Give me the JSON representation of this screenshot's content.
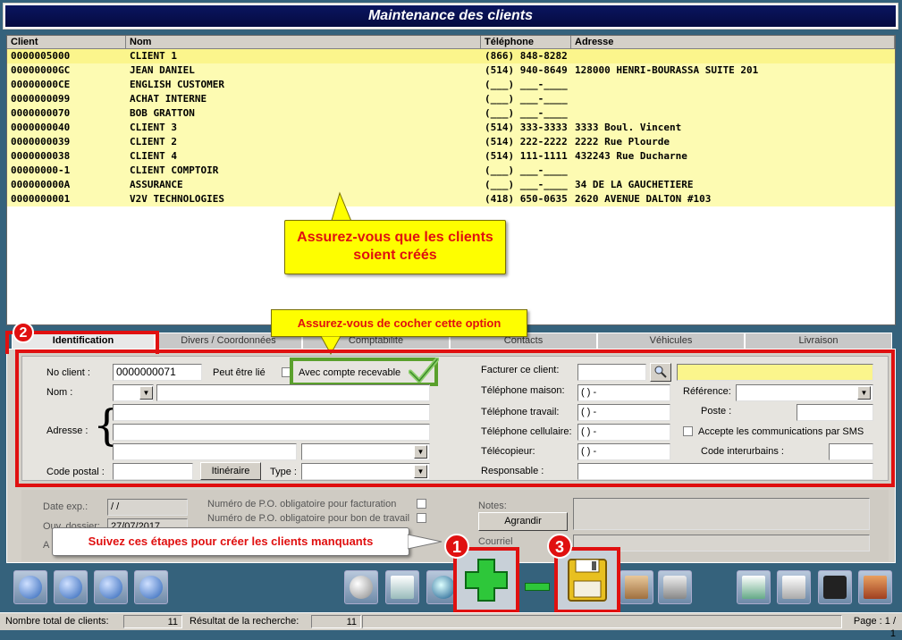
{
  "window": {
    "title": "Maintenance des clients"
  },
  "grid": {
    "headers": [
      "Client",
      "Nom",
      "Téléphone",
      "Adresse"
    ],
    "rows": [
      [
        "0000005000",
        "CLIENT 1",
        "(866) 848-8282",
        ""
      ],
      [
        "00000000GC",
        "JEAN DANIEL",
        "(514) 940-8649",
        "128000 HENRI-BOURASSA SUITE 201"
      ],
      [
        "00000000CE",
        "ENGLISH CUSTOMER",
        "(___) ___-____",
        ""
      ],
      [
        "0000000099",
        "ACHAT INTERNE",
        "(___) ___-____",
        ""
      ],
      [
        "0000000070",
        "BOB GRATTON",
        "(___) ___-____",
        ""
      ],
      [
        "0000000040",
        "CLIENT 3",
        "(514) 333-3333",
        "3333 Boul. Vincent"
      ],
      [
        "0000000039",
        "CLIENT 2",
        "(514) 222-2222",
        "2222 Rue Plourde"
      ],
      [
        "0000000038",
        "CLIENT 4",
        "(514) 111-1111",
        "432243 Rue Ducharne"
      ],
      [
        "00000000-1",
        "CLIENT COMPTOIR",
        "(___) ___-____",
        ""
      ],
      [
        "000000000A",
        "ASSURANCE",
        "(___) ___-____",
        "34 DE LA GAUCHETIERE"
      ],
      [
        "0000000001",
        "V2V TECHNOLOGIES",
        "(418) 650-0635",
        "2620 AVENUE DALTON #103"
      ]
    ]
  },
  "callouts": {
    "clients": "Assurez-vous que les clients soient créés",
    "option": "Assurez-vous de cocher cette option",
    "steps": "Suivez ces étapes pour créer les clients manquants"
  },
  "badges": {
    "one": "1",
    "two": "2",
    "three": "3"
  },
  "tabs": [
    "Identification",
    "Divers / Coordonnées",
    "Comptabilité",
    "Contacts",
    "Véhicules",
    "Livraison"
  ],
  "form": {
    "no_client_label": "No client :",
    "no_client_value": "0000000071",
    "peut_etre_lie": "Peut être lié",
    "avec_compte": "Avec compte recevable",
    "nom_label": "Nom :",
    "adresse_label": "Adresse :",
    "code_postal_label": "Code postal :",
    "itineraire": "Itinéraire",
    "type_label": "Type :",
    "facturer_label": "Facturer ce client:",
    "tel_maison_label": "Téléphone maison:",
    "tel_travail_label": "Téléphone travail:",
    "tel_cell_label": "Téléphone cellulaire:",
    "telecopieur_label": "Télécopieur:",
    "responsable_label": "Responsable :",
    "phone_mask": "(   )    -",
    "reference_label": "Référence:",
    "poste_label": "Poste :",
    "sms_label": "Accepte les communications par SMS",
    "interurbains_label": "Code interurbains :"
  },
  "lower": {
    "date_exp_label": "Date exp.:",
    "date_exp_value": "/  /",
    "ouv_label": "Ouv. dossier:",
    "ouv_value": "27/07/2017",
    "po_facturation": "Numéro de P.O. obligatoire pour facturation",
    "po_bon_travail": "Numéro de P.O. obligatoire pour bon de travail",
    "notes_label": "Notes:",
    "agrandir": "Agrandir",
    "courriel_label": "Courriel",
    "a_label": "A"
  },
  "status": {
    "total_label": "Nombre total de clients:",
    "total_value": "11",
    "result_label": "Résultat de la recherche:",
    "result_value": "11",
    "page": "Page : 1 / 1"
  },
  "colors": {
    "highlight": "#e01010",
    "row": "#fdfbb2",
    "callout": "#fefe00",
    "title_bg": "#0a1560"
  }
}
